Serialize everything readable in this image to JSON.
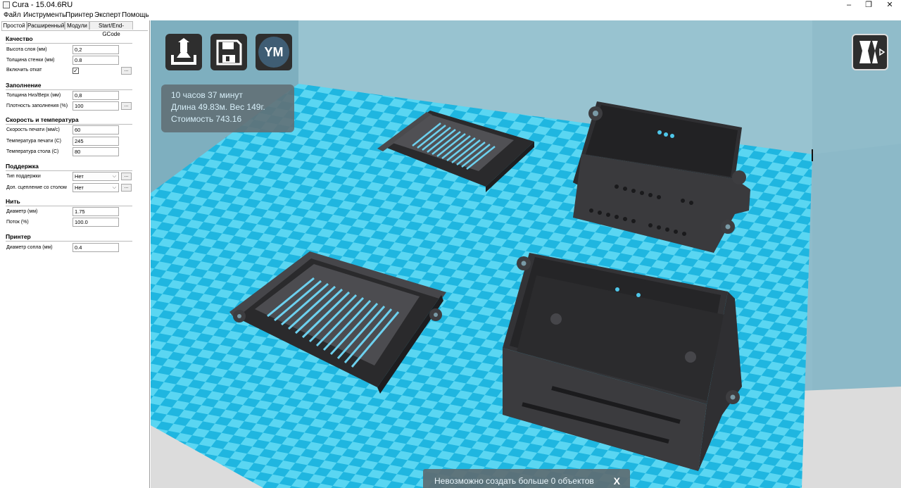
{
  "window": {
    "title": "Cura - 15.04.6RU",
    "minimize": "–",
    "maximize": "❐",
    "close": "✕"
  },
  "menu": [
    "Файл",
    "Инструменты",
    "Принтер",
    "Эксперт",
    "Помощь"
  ],
  "tabs": [
    "Простой",
    "Расширенный",
    "Модули",
    "Start/End-GCode"
  ],
  "sections": {
    "quality": "Качество",
    "fill": "Заполнение",
    "speed": "Скорость и температура",
    "support": "Поддержка",
    "filament": "Нить",
    "printer": "Принтер"
  },
  "fields": {
    "layer_height": {
      "label": "Высота слоя (мм)",
      "value": "0,2"
    },
    "wall_thickness": {
      "label": "Толщина стенки (мм)",
      "value": "0.8"
    },
    "retraction": {
      "label": "Включить откат",
      "checked": "✓"
    },
    "bottom_top": {
      "label": "Толщина Низ/Верх (мм)",
      "value": "0,8"
    },
    "fill_density": {
      "label": "Плотность заполнения (%)",
      "value": "100"
    },
    "print_speed": {
      "label": "Скорость печати (мм/с)",
      "value": "60"
    },
    "print_temp": {
      "label": "Температура печати (С)",
      "value": "245"
    },
    "bed_temp": {
      "label": "Температура стола (С)",
      "value": "80"
    },
    "support_type": {
      "label": "Тип поддержки",
      "value": "Нет"
    },
    "adhesion": {
      "label": "Доп. сцепление со столом",
      "value": "Нет"
    },
    "diameter": {
      "label": "Диаметр (мм)",
      "value": "1.75"
    },
    "flow": {
      "label": "Поток (%)",
      "value": "100.0"
    },
    "nozzle": {
      "label": "Диаметр сопла (мм)",
      "value": "0.4"
    }
  },
  "dots_label": "...",
  "toolbar": {
    "load": "load-icon",
    "save": "save-icon",
    "ym_label": "YM",
    "view": "view-mode-icon"
  },
  "info": {
    "time": "10 часов 37 минут",
    "length_weight": "Длина 49.83м. Вес 149г.",
    "cost": "Стоимость 743.16"
  },
  "toast": {
    "message": "Невозможно создать больше 0 объектов",
    "close": "X"
  },
  "colors": {
    "bed_light": "#55d4f0",
    "bed_dark": "#1bb3de",
    "model": "#3a3a3d",
    "background": "#86b4c4"
  }
}
